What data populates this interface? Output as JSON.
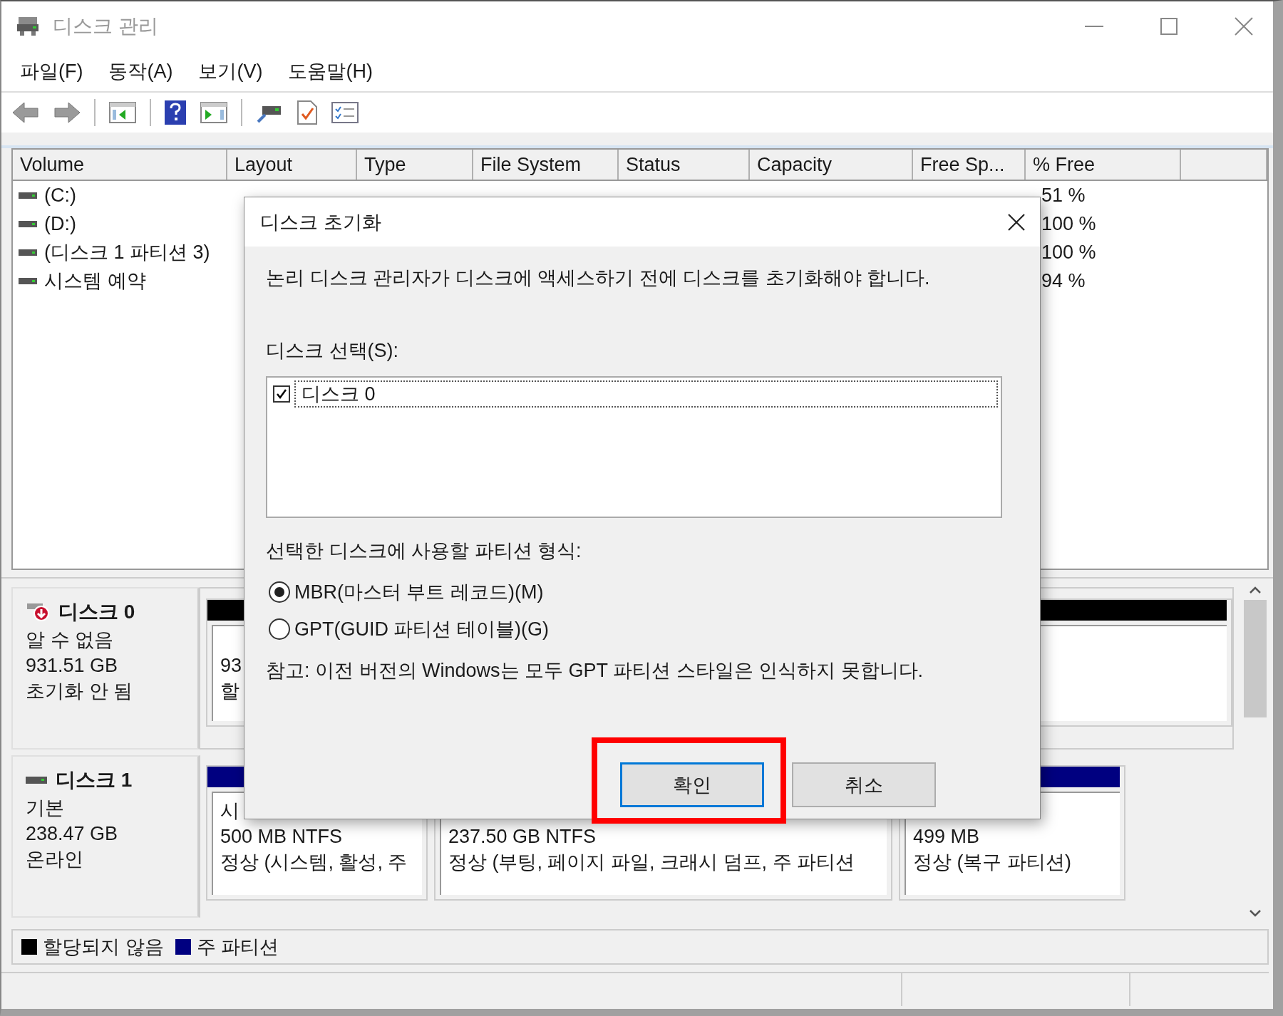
{
  "window": {
    "title": "디스크 관리"
  },
  "menu": [
    {
      "label": "파일(F)"
    },
    {
      "label": "동작(A)"
    },
    {
      "label": "보기(V)"
    },
    {
      "label": "도움말(H)"
    }
  ],
  "volume_table": {
    "columns": [
      "Volume",
      "Layout",
      "Type",
      "File System",
      "Status",
      "Capacity",
      "Free Sp...",
      "% Free"
    ],
    "rows": [
      {
        "volume": "(C:)",
        "free_pct": "51 %"
      },
      {
        "volume": "(D:)",
        "free_pct": "100 %"
      },
      {
        "volume": "(디스크 1 파티션 3)",
        "free_pct": "100 %"
      },
      {
        "volume": "시스템 예약",
        "free_pct": "94 %"
      }
    ]
  },
  "disks": [
    {
      "name": "디스크 0",
      "kind": "error",
      "lines": [
        "알 수 없음",
        "931.51 GB",
        "초기화 안 됨"
      ],
      "partitions": [
        {
          "color": "#000000",
          "lines": [
            "93",
            "할"
          ]
        }
      ]
    },
    {
      "name": "디스크 1",
      "kind": "normal",
      "lines": [
        "기본",
        "238.47 GB",
        "온라인"
      ],
      "partitions": [
        {
          "color": "#000080",
          "lines": [
            "시",
            "500 MB NTFS",
            "정상 (시스템, 활성, 주"
          ]
        },
        {
          "lines": [
            "237.50 GB NTFS",
            "정상 (부팅, 페이지 파일, 크래시 덤프, 주 파티션"
          ]
        },
        {
          "color": "#000080",
          "lines": [
            "499 MB",
            "정상 (복구 파티션)"
          ]
        }
      ]
    }
  ],
  "legend": [
    {
      "color": "#000000",
      "label": "할당되지 않음"
    },
    {
      "color": "#000080",
      "label": "주 파티션"
    }
  ],
  "dialog": {
    "title": "디스크 초기화",
    "message": "논리 디스크 관리자가 디스크에 액세스하기 전에 디스크를 초기화해야 합니다.",
    "select_label": "디스크 선택(S):",
    "disks": [
      {
        "label": "디스크 0",
        "checked": true
      }
    ],
    "style_label": "선택한 디스크에 사용할 파티션 형식:",
    "options": [
      {
        "label": "MBR(마스터 부트 레코드)(M)",
        "selected": true
      },
      {
        "label": "GPT(GUID 파티션 테이블)(G)",
        "selected": false
      }
    ],
    "note": "참고: 이전 버전의 Windows는 모두 GPT 파티션 스타일은 인식하지 못합니다.",
    "buttons": [
      {
        "label": "확인",
        "kind": "default",
        "highlighted": true
      },
      {
        "label": "취소",
        "kind": "normal",
        "highlighted": false
      }
    ]
  }
}
